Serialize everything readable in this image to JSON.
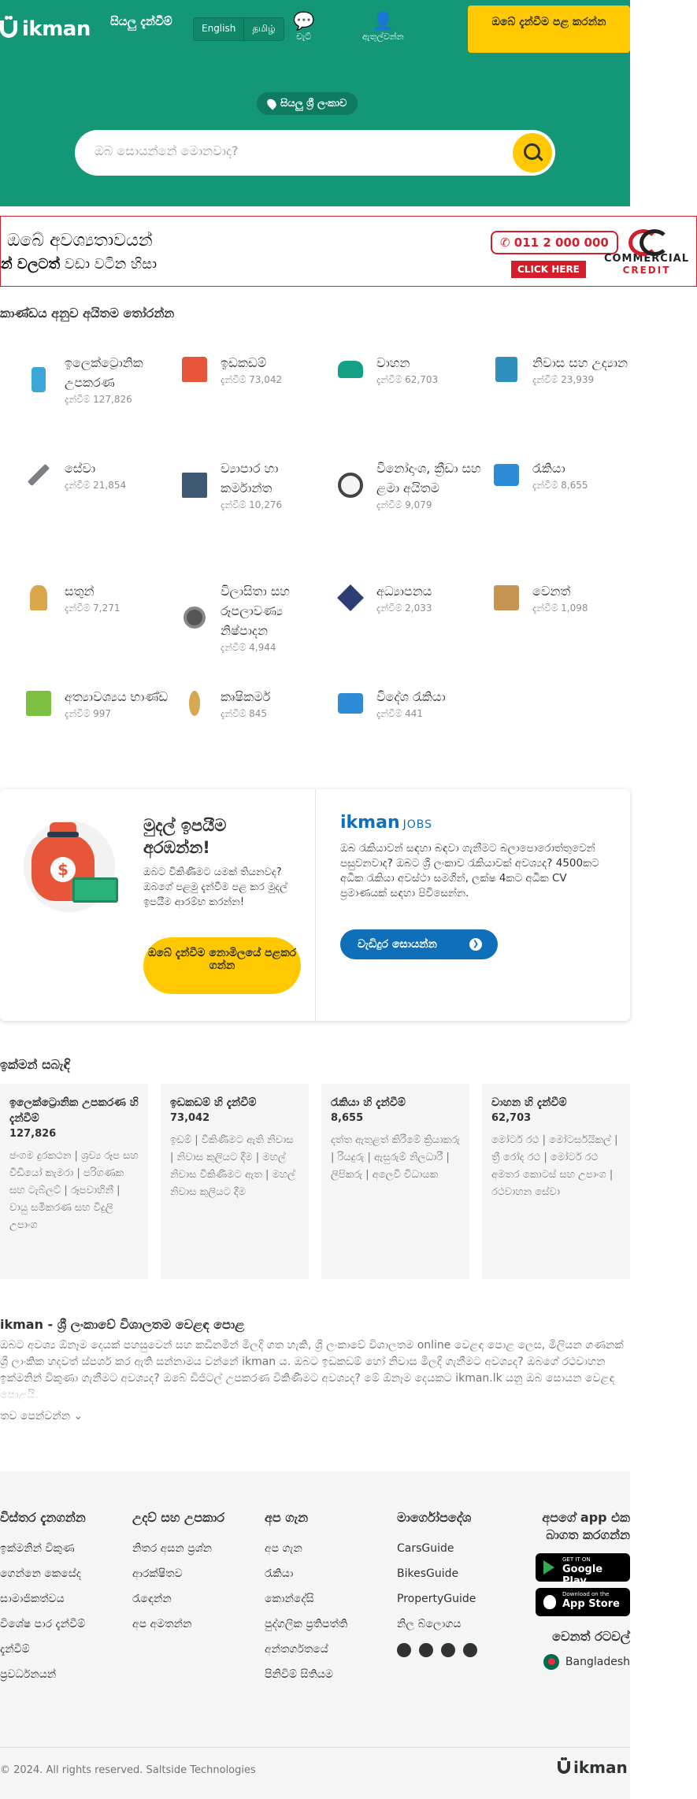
{
  "header": {
    "logo_text": "ikman",
    "all_ads": "සියලු දැන්වීම්",
    "lang_en": "English",
    "lang_ta": "தமிழ்",
    "chat_label": "චැට්",
    "account_label": "ඇතුල්වන්න",
    "post_ad": "ඔබේ දැන්වීම පළ කරන්න",
    "location": "සියලු ශ්‍රී ලංකාව",
    "search_placeholder": "ඔබ සොයන්නේ මොනවාද?"
  },
  "banner": {
    "line1": "ඔබේ අවශ්‍යතාවයන්",
    "line2_bold": "න් වලටත්",
    "line2_rest": "වඩා වටින හිසා",
    "phone": "011 2 000 000",
    "click": "CLICK HERE",
    "brand1": "COMMERCIAL",
    "brand2": "CREDIT"
  },
  "categories_title": "කාණ්ඩය අනුව අයිතම තෝරන්න",
  "categories": [
    {
      "name": "ඉලෙක්ට්‍රොනික උපකරණ",
      "count": "දැන්වීම් 127,826",
      "icon": "phone-icon"
    },
    {
      "name": "ඉඩකඩම්",
      "count": "දැන්වීම් 73,042",
      "icon": "house-icon"
    },
    {
      "name": "වාහන",
      "count": "දැන්වීම් 62,703",
      "icon": "car-icon"
    },
    {
      "name": "නිවාස සහ උද්‍යාන",
      "count": "දැන්වීම් 23,939",
      "icon": "appliance-icon"
    },
    {
      "name": "සේවා",
      "count": "දැන්වීම් 21,854",
      "icon": "tools-icon"
    },
    {
      "name": "ව්‍යාපාර හා කර්මාන්ත",
      "count": "දැන්වීම් 10,276",
      "icon": "factory-icon"
    },
    {
      "name": "විනෝදාංශ, ක්‍රීඩා සහ ළමා අයිතම",
      "count": "දැන්වීම් 9,079",
      "icon": "football-icon"
    },
    {
      "name": "රැකියා",
      "count": "දැන්වීම් 8,655",
      "icon": "briefcase-icon"
    },
    {
      "name": "සතුන්",
      "count": "දැන්වීම් 7,271",
      "icon": "dog-icon"
    },
    {
      "name": "විලාසිතා සහ රූපලාවණ්‍ය නිෂ්පාදන",
      "count": "දැන්වීම් 4,944",
      "icon": "watch-icon"
    },
    {
      "name": "අධ්‍යාපනය",
      "count": "දැන්වීම් 2,033",
      "icon": "graduation-cap-icon"
    },
    {
      "name": "වෙනත්",
      "count": "දැන්වීම් 1,098",
      "icon": "box-icon"
    },
    {
      "name": "අත්‍යාවශ්‍යය භාණ්ඩ",
      "count": "දැන්වීම් 997",
      "icon": "grocery-icon"
    },
    {
      "name": "කෘෂිකර්ම",
      "count": "දැන්වීම් 845",
      "icon": "wheat-icon"
    },
    {
      "name": "විදේශ රැකියා",
      "count": "දැන්වීම් 441",
      "icon": "globe-briefcase-icon"
    }
  ],
  "promo": {
    "title": "මුදල් ඉපයීම අරඹන්න!",
    "desc": "ඔබට විකිණීමට යමක් තියනවද? ඔබගේ පළමු දැන්වීම පළ කර මුදල් ඉපයීම ආරම්භ කරන්න!",
    "button": "ඔබේ දැන්වීම නොමිලයේ පළකර ගන්න",
    "jobs_brand": "ikman",
    "jobs_suffix": "JOBS",
    "jobs_desc": "ඔබ රැකියාවන් සඳහා බඳවා ගැනීමට බලාපොරොත්තුවෙන් පසුවනවාද? ඔබට ශ්‍රී ලංකාව රැකියාවක් අවශ්‍යද? 4500කට අධික රැකියා අවස්ථා සමගින්, ලක්ෂ 4කට අධික CV ප්‍රමාණයක් සඳහා පිවිසෙන්න.",
    "jobs_button": "වැඩිදුර සොයන්න"
  },
  "quick_title": "ඉක්මන් සබැඳි",
  "quick": [
    {
      "title": "ඉලෙක්ට්‍රොනික උපකරණ හි දැන්වීම්",
      "count": "127,826",
      "body": "ජංගම දුරකථන | ශ්‍රව්‍ය රූප සහ වීඩියෝ කැමරා | පරිගණක සහ ටැබ්ලට් | රූපවාහිනී | වායු සමීකරණ සහ විදුලි උපාංග"
    },
    {
      "title": "ඉඩකඩම් හි දැන්වීම්",
      "count": "73,042",
      "body": "ඉඩම් | විකිණීමට ඇති නිවාස | නිවාස කුලියට දීම | මහල් නිවාස විකිණීමට ඇත | මහල් නිවාස කුලියට දීම"
    },
    {
      "title": "රැකියා හි දැන්වීම්",
      "count": "8,655",
      "body": "දත්ත ඇතුළත් කිරීමේ ක්‍රියාකරු | රියදුරු | ඇසුරුම් නිලධාරී | ලිපිකරු | අලෙවි විධායක"
    },
    {
      "title": "වාහන හි දැන්වීම්",
      "count": "62,703",
      "body": "මෝටර් රථ | මෝටර්සයිකල් | ත්‍රී රෝද රථ | මෝටර් රථ අමතර කොටස් සහ උපාංග | රථවාහන සේවා"
    }
  ],
  "seo": {
    "title": "ikman - ශ්‍රී ලංකාවේ විශාලතම වෙළඳ පොළ",
    "text": "ඔබට අවශ්‍ය ඕනෑම දෙයක් පහසුවෙන් සහ කඩිනමින් මිලදී ගත හැකි, ශ්‍රී ලංකාවේ විශාලතම online වෙළඳ පොළ ලෙස, මිලියන ගණනක් ශ්‍රී ලාංකික හදවත් ස්පර්ශ කර ඇති සන්නාමය වන්නේ ikman ය. ඔබට ඉඩකඩම් හෝ නිවාස මිලදී ගැනීමට අවශ්‍යද? ඔබගේ රථවාහන ඉක්මනින් විකුණා ගැනීමට අවශ්‍යද? ඔබේ ඩිජිටල් උපකරණ විකිණීමට අවශ්‍යද? මේ ඕනෑම දෙයකට ikman.lk යනු ඔබ සොයන වෙළඳ පොළයි.",
    "more": "තව පෙන්වන්න"
  },
  "footer": {
    "col1_title": "විස්තර දැනගන්න",
    "col1": [
      "ඉක්මනින් විකුණ",
      "ගෙන්නෙ කෙසේද",
      "සාමාජිකත්වය",
      "විශේෂ පාර දැන්වීම්",
      "දැන්වීම්",
      "ප්‍රවර්ධනයන්"
    ],
    "col2_title": "උදව් සහ උපකාර",
    "col2": [
      "නිතර අසන ප්‍රශ්න",
      "ආරක්ෂිතව",
      "රැඳෙන්න",
      "අප අමතන්න"
    ],
    "col3_title": "අප ගැන",
    "col3": [
      "අප ගැන",
      "රැකියා",
      "කොන්දේසි",
      "පුද්ගලික ප්‍රතිපත්ති",
      "අන්තර්ගතයේ",
      "පිනිවිම් සිතියම"
    ],
    "col4_title": "මාර්ගෝපදේශ",
    "col4": [
      "CarsGuide",
      "BikesGuide",
      "PropertyGuide",
      "නිල බ්ලොගය"
    ],
    "app_title": "අපගේ app එක බාගත කරගන්න",
    "gp_small": "GET IT ON",
    "gp_big": "Google Play",
    "as_small": "Download on the",
    "as_big": "App Store",
    "other_countries": "වෙනත් රටවල්",
    "country": "Bangladesh",
    "copyright": "© 2024. All rights reserved. Saltside Technologies",
    "logo_text": "ikman"
  },
  "colors": {
    "brand_green": "#149777",
    "brand_yellow": "#ffc800",
    "jobs_blue": "#0f6fb8",
    "banner_red": "#d21f2b"
  }
}
